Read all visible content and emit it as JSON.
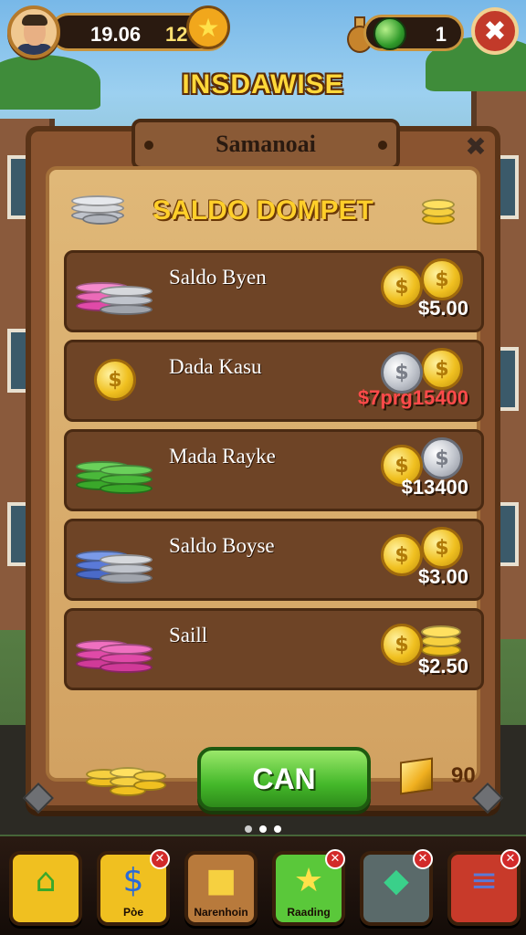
{
  "hud": {
    "money": "19.06",
    "level": "12",
    "gems": "1"
  },
  "game_title": "INSDAWISE",
  "panel": {
    "header": "Samanoai",
    "wallet_title": "SALDO DOMPET",
    "rows": [
      {
        "name": "Saldo Byen",
        "amount": "$5.00",
        "chip_color": "#e04aa8",
        "amount_color": "white"
      },
      {
        "name": "Dada Kasu",
        "amount": "$7prg15400",
        "chip_color": "gold",
        "amount_color": "red"
      },
      {
        "name": "Mada Rayke",
        "amount": "$13400",
        "chip_color": "#4ab83a",
        "amount_color": "white"
      },
      {
        "name": "Saldo Boyse",
        "amount": "$3.00",
        "chip_color": "#5a7ad8",
        "amount_color": "white"
      },
      {
        "name": "Saill",
        "amount": "$2.50",
        "chip_color": "#e04aa8",
        "amount_color": "white"
      }
    ],
    "action_button": "CAN",
    "cube_count": "90"
  },
  "pagination": {
    "total": 3,
    "active": 2
  },
  "nav": [
    {
      "label": "",
      "icon": "house-icon",
      "color": "#f0c020"
    },
    {
      "label": "Pòe",
      "icon": "dollar-cube-icon",
      "color": "#f0c020"
    },
    {
      "label": "Narenhoin",
      "icon": "gold-cube-icon",
      "color": "#b87a3c"
    },
    {
      "label": "Raading",
      "icon": "star-icon",
      "color": "#5ac83a"
    },
    {
      "label": "",
      "icon": "gem-icon",
      "color": "#5a6a6a"
    },
    {
      "label": "",
      "icon": "coin-stack-icon",
      "color": "#c83a2a"
    }
  ],
  "colors": {
    "panel_wood": "#8a5430",
    "panel_inner": "#d2a262",
    "title_yellow": "#ffd83a",
    "button_green": "#44b82a"
  }
}
